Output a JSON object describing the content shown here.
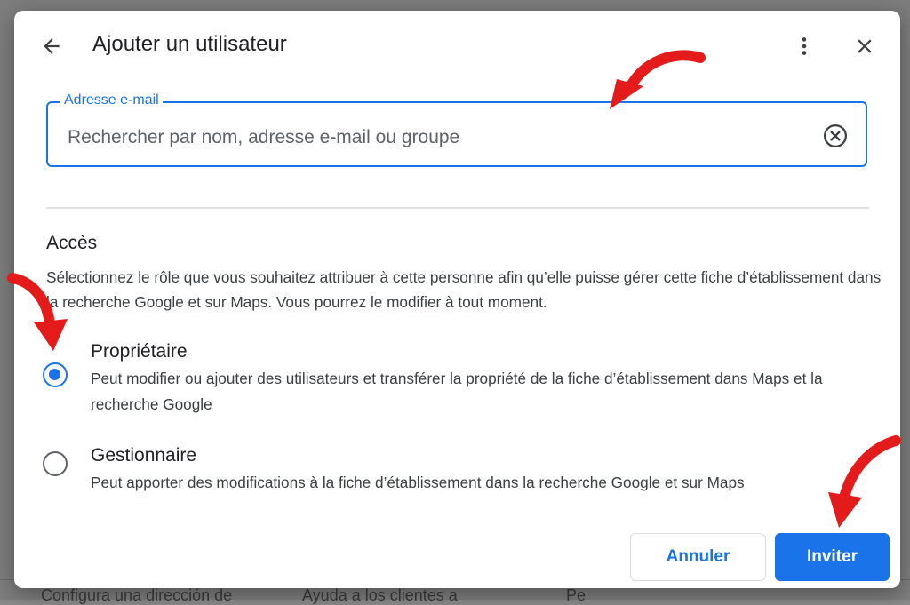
{
  "background": {
    "bottom_texts": [
      "Configura una dirección de",
      "Ayuda a los clientes a",
      "Pe"
    ]
  },
  "dialog": {
    "title": "Ajouter un utilisateur",
    "back_icon": "arrow-back-icon",
    "more_icon": "more-vert-icon",
    "close_icon": "close-icon",
    "email_field": {
      "label": "Adresse e-mail",
      "placeholder": "Rechercher par nom, adresse e-mail ou groupe",
      "value": "",
      "clear_icon": "cancel-circle-icon"
    },
    "access": {
      "title": "Accès",
      "description": "Sélectionnez le rôle que vous souhaitez attribuer à cette personne afin qu’elle puisse gérer cette fiche d’établissement dans la recherche Google et sur Maps. Vous pourrez le modifier à tout moment.",
      "options": [
        {
          "title": "Propriétaire",
          "description": "Peut modifier ou ajouter des utilisateurs et transférer la propriété de la fiche d’établissement dans Maps et la recherche Google",
          "selected": true
        },
        {
          "title": "Gestionnaire",
          "description": "Peut apporter des modifications à la fiche d’établissement dans la recherche Google et sur Maps",
          "selected": false
        }
      ]
    },
    "buttons": {
      "cancel": "Annuler",
      "invite": "Inviter"
    }
  },
  "colors": {
    "accent": "#1a73e8",
    "annotation_arrow": "#e41b1b"
  }
}
